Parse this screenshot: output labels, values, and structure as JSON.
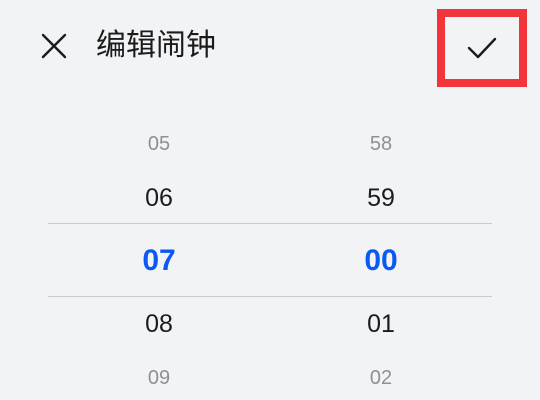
{
  "header": {
    "title": "编辑闹钟"
  },
  "picker": {
    "hours": [
      "05",
      "06",
      "07",
      "08",
      "09"
    ],
    "minutes": [
      "58",
      "59",
      "00",
      "01",
      "02"
    ],
    "selected_hour": "07",
    "selected_minute": "00"
  },
  "colors": {
    "accent": "#0a59f7",
    "highlight_box": "#f2343b",
    "background": "#f1f3f5"
  },
  "icons": {
    "close": "close-icon",
    "confirm": "checkmark-icon"
  }
}
